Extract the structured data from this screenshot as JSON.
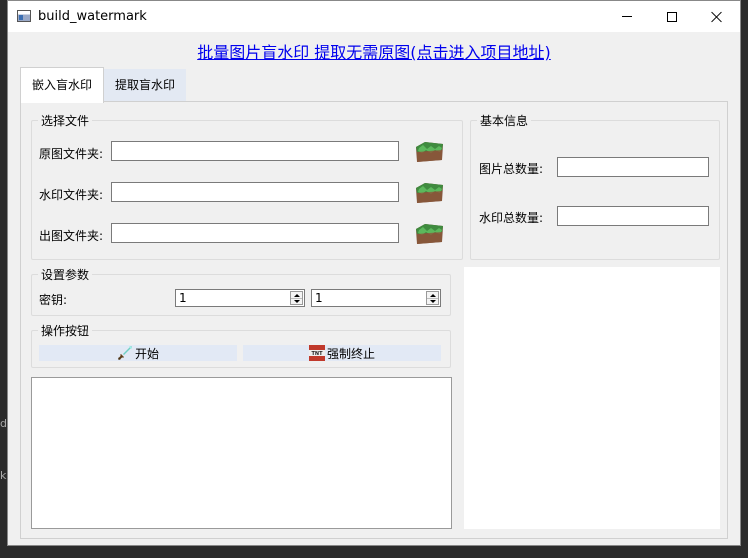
{
  "window": {
    "title": "build_watermark",
    "controls": {
      "minimize": "minimize",
      "maximize": "maximize",
      "close": "close"
    }
  },
  "header": {
    "link_text": "批量图片盲水印 提取无需原图(点击进入项目地址)",
    "link_color": "#0000ee"
  },
  "tabs": [
    {
      "label": "嵌入盲水印",
      "active": true
    },
    {
      "label": "提取盲水印",
      "active": false
    }
  ],
  "select_files": {
    "title": "选择文件",
    "rows": [
      {
        "label": "原图文件夹:",
        "value": "",
        "icon": "folder-grass-icon"
      },
      {
        "label": "水印文件夹:",
        "value": "",
        "icon": "folder-grass-icon"
      },
      {
        "label": "出图文件夹:",
        "value": "",
        "icon": "folder-grass-icon"
      }
    ]
  },
  "basic_info": {
    "title": "基本信息",
    "image_count_label": "图片总数量:",
    "image_count_value": "",
    "watermark_count_label": "水印总数量:",
    "watermark_count_value": ""
  },
  "settings": {
    "title": "设置参数",
    "key_label": "密钥:",
    "key1": "1",
    "key2": "1"
  },
  "actions": {
    "title": "操作按钮",
    "start_label": "开始",
    "start_icon": "sword-icon",
    "stop_label": "强制终止",
    "stop_icon": "tnt-icon",
    "button_color": "#e2e9f5"
  },
  "log": {
    "text": ""
  },
  "background": {
    "left_snippet": "d",
    "left_snippet2": "k"
  }
}
